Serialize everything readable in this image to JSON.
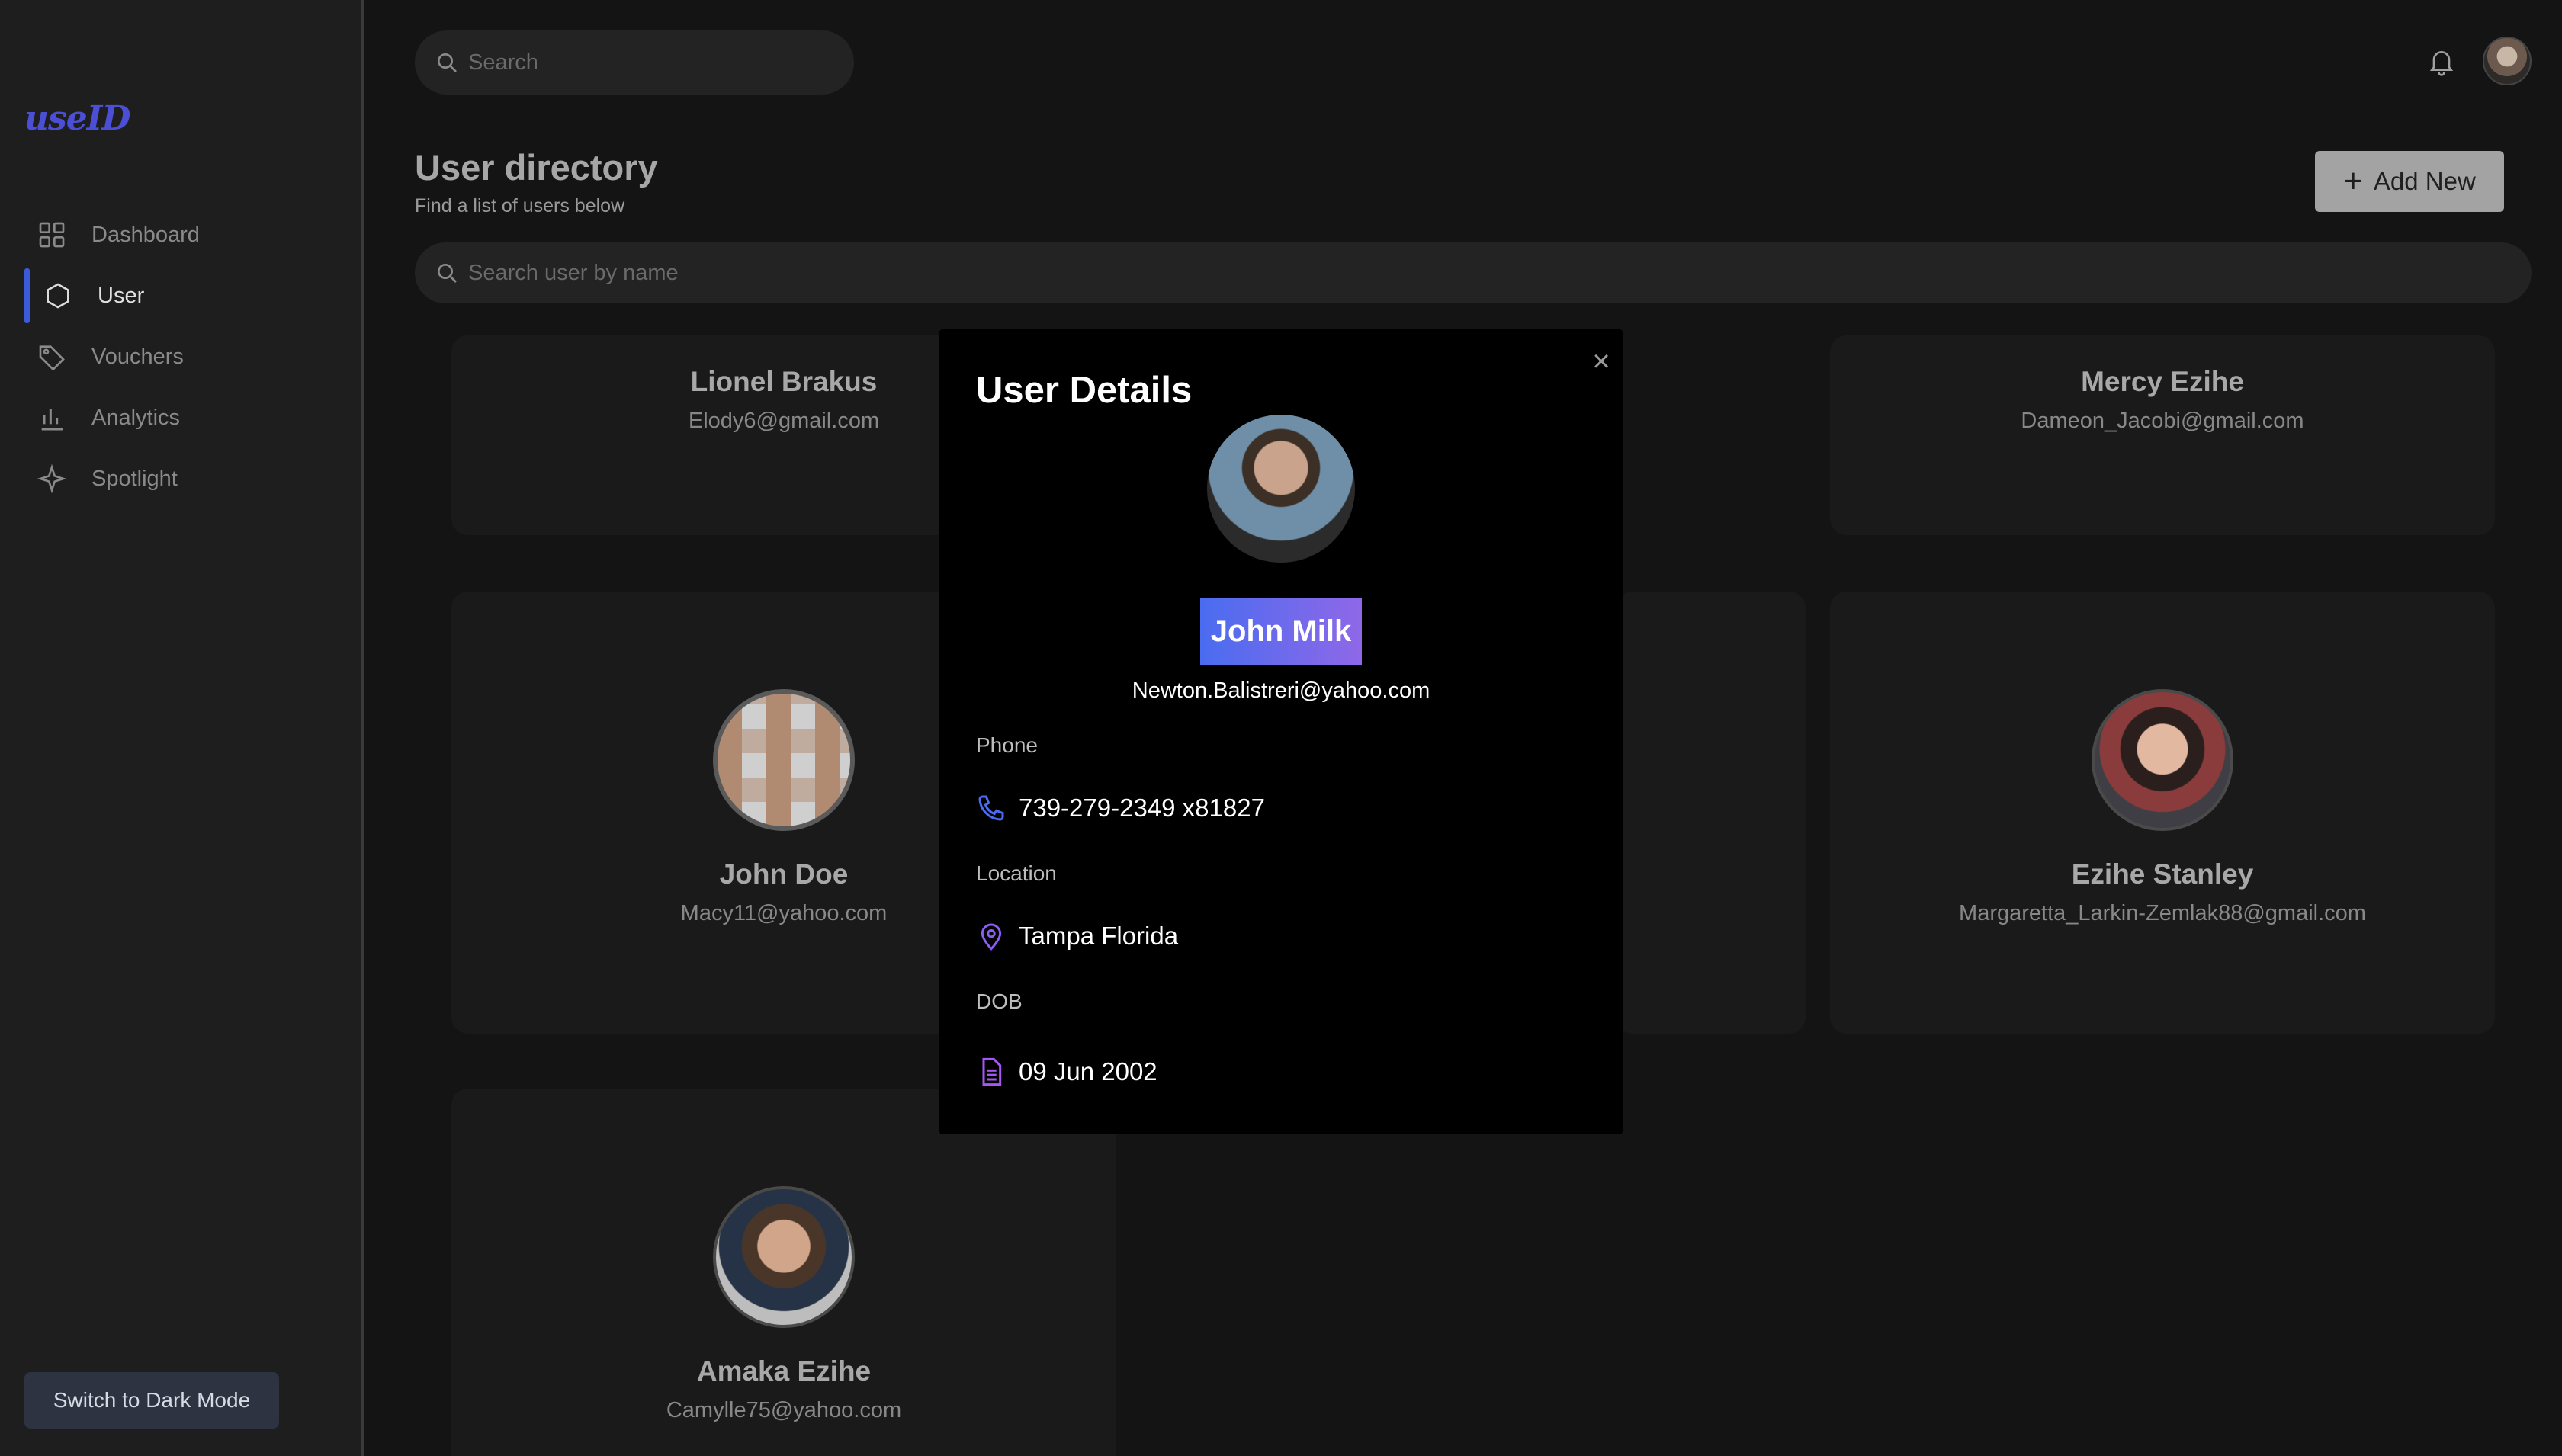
{
  "app": {
    "logo": "useID",
    "nav": [
      {
        "label": "Dashboard",
        "icon": "grid-icon"
      },
      {
        "label": "User",
        "icon": "hexagon-icon"
      },
      {
        "label": "Vouchers",
        "icon": "tag-icon"
      },
      {
        "label": "Analytics",
        "icon": "bar-chart-icon"
      },
      {
        "label": "Spotlight",
        "icon": "sparkle-icon"
      }
    ],
    "active_nav": "User",
    "dark_mode_button": "Switch to Dark Mode"
  },
  "header": {
    "search_placeholder": "Search"
  },
  "directory": {
    "title": "User directory",
    "subtitle": "Find a list of users below",
    "add_button": "Add New",
    "search_placeholder": "Search user by name",
    "users": [
      {
        "name": "Lionel Brakus",
        "email": "Elody6@gmail.com"
      },
      {
        "name": "Mercy Ezihe",
        "email": "Dameon_Jacobi@gmail.com"
      },
      {
        "name": "John Doe",
        "email": "Macy11@yahoo.com"
      },
      {
        "name": "Ezihe Stanley",
        "email": "Margaretta_Larkin-Zemlak88@gmail.com"
      },
      {
        "name": "Amaka Ezihe",
        "email": "Camylle75@yahoo.com"
      }
    ]
  },
  "modal": {
    "title": "User Details",
    "name": "John Milk",
    "email": "Newton.Balistreri@yahoo.com",
    "phone_label": "Phone",
    "phone": "739-279-2349 x81827",
    "location_label": "Location",
    "location": "Tampa Florida",
    "dob_label": "DOB",
    "dob": "09 Jun 2002",
    "close_icon": "close-icon"
  },
  "colors": {
    "accent": "#3b5bdb",
    "name_gradient_start": "#4a6cf0",
    "name_gradient_end": "#8f68e8",
    "icon_phone": "#4a6cf0",
    "icon_pin": "#8b5cf6",
    "icon_doc": "#a855f7"
  }
}
